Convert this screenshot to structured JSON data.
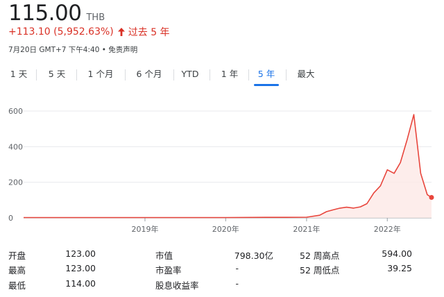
{
  "header": {
    "price": "115.00",
    "currency": "THB",
    "change": "+113.10 (5,952.63%)",
    "period": "过去 5 年",
    "meta": "7月20日 GMT+7 下午4:40 • 免责声明"
  },
  "tabs": [
    "1 天",
    "5 天",
    "1 个月",
    "6 个月",
    "YTD",
    "1 年",
    "5 年",
    "最大"
  ],
  "active_tab": "5 年",
  "colors": {
    "line": "#e8453c",
    "fill": "#fce8e6",
    "accent": "#1a73e8",
    "negative": "#d93025"
  },
  "chart_data": {
    "type": "area",
    "y_ticks": [
      0,
      200,
      400,
      600
    ],
    "x_ticks": [
      "2019年",
      "2020年",
      "2021年",
      "2022年"
    ],
    "ylim": [
      0,
      640
    ],
    "grid": true,
    "x": [
      "2017-07",
      "2018-01",
      "2018-07",
      "2019-01",
      "2019-07",
      "2020-01",
      "2020-07",
      "2020-10",
      "2021-01",
      "2021-03",
      "2021-04",
      "2021-05",
      "2021-06",
      "2021-07",
      "2021-08",
      "2021-09",
      "2021-10",
      "2021-11",
      "2021-12",
      "2022-01",
      "2022-02",
      "2022-03",
      "2022-04",
      "2022-05",
      "2022-06",
      "2022-07",
      "2022-07-20"
    ],
    "values": [
      2,
      2,
      2,
      2,
      2,
      2,
      3,
      3,
      4,
      15,
      35,
      45,
      55,
      60,
      55,
      62,
      80,
      140,
      180,
      270,
      250,
      310,
      440,
      580,
      250,
      130,
      115
    ]
  },
  "stats": [
    {
      "label": "开盘",
      "value": "123.00"
    },
    {
      "label": "最高",
      "value": "123.00"
    },
    {
      "label": "最低",
      "value": "114.00"
    },
    {
      "label": "市值",
      "value": "798.30亿"
    },
    {
      "label": "市盈率",
      "value": "-"
    },
    {
      "label": "股息收益率",
      "value": "-"
    },
    {
      "label": "52 周高点",
      "value": "594.00"
    },
    {
      "label": "52 周低点",
      "value": "39.25"
    }
  ]
}
